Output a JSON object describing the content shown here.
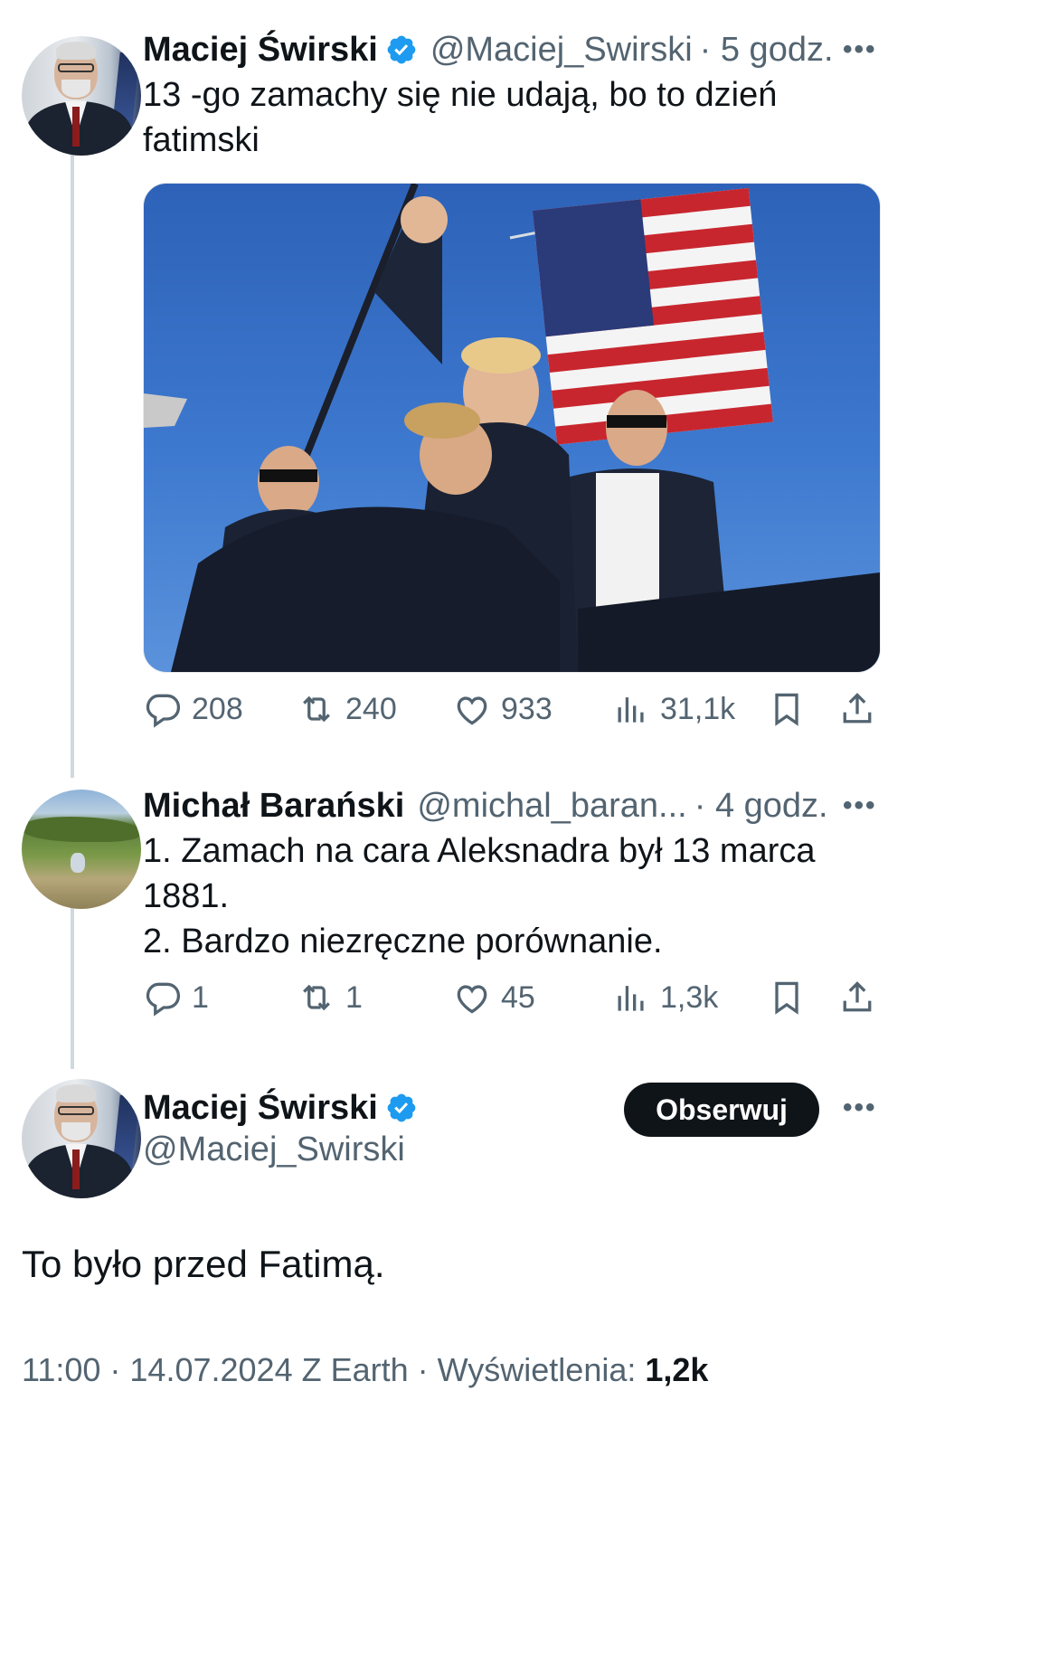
{
  "colors": {
    "text": "#0f1419",
    "secondary": "#536471",
    "verified": "#1d9bf0",
    "thread_line": "#cfd9de",
    "button_bg": "#0f1419"
  },
  "thread": [
    {
      "name": "Maciej Świrski",
      "handle": "@Maciej_Swirski",
      "time": "· 5 godz.",
      "verified": true,
      "text_lines": [
        "13 -go zamachy się nie udają, bo to dzień",
        "fatimski"
      ],
      "has_media": true,
      "media_description_icon": "photo-icon",
      "stats": {
        "replies": "208",
        "reposts": "240",
        "likes": "933",
        "views": "31,1k"
      }
    },
    {
      "name": "Michał Barański",
      "handle": "@michal_baran...",
      "time": "· 4 godz.",
      "verified": false,
      "text_lines": [
        "1. Zamach na cara Aleksnadra był 13 marca",
        "1881.",
        "2. Bardzo niezręczne porównanie."
      ],
      "stats": {
        "replies": "1",
        "reposts": "1",
        "likes": "45",
        "views": "1,3k"
      }
    }
  ],
  "main": {
    "name": "Maciej Świrski",
    "handle": "@Maciej_Swirski",
    "follow_label": "Obserwuj",
    "text": "To było przed Fatimą.",
    "meta_prefix": "11:00 · 14.07.2024 Z Earth · Wyświetlenia: ",
    "views": "1,2k"
  },
  "more_label": "•••"
}
